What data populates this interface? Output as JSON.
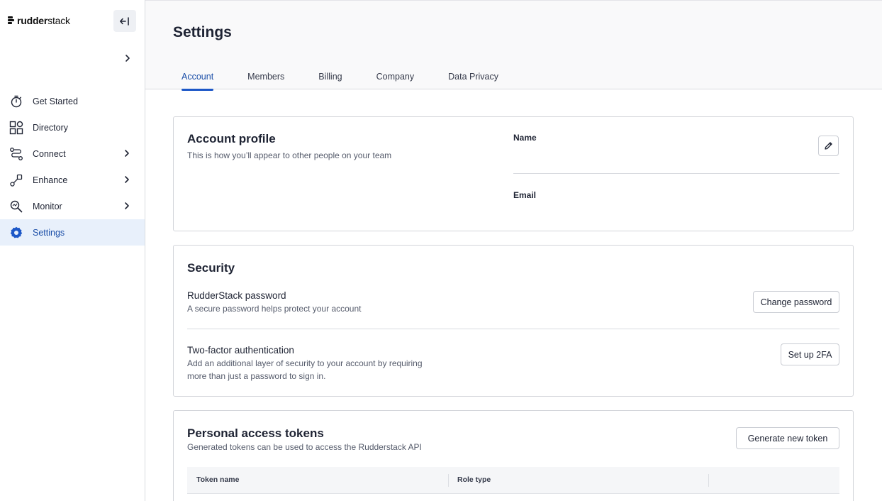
{
  "brand": {
    "logo_text_bold": "rudder",
    "logo_text_regular": "stack"
  },
  "sidebar": {
    "items": [
      {
        "label": "Get Started",
        "icon": "stopwatch-icon",
        "has_chevron": false,
        "active": false
      },
      {
        "label": "Directory",
        "icon": "grid-icon",
        "has_chevron": false,
        "active": false
      },
      {
        "label": "Connect",
        "icon": "connect-icon",
        "has_chevron": true,
        "active": false
      },
      {
        "label": "Enhance",
        "icon": "enhance-icon",
        "has_chevron": true,
        "active": false
      },
      {
        "label": "Monitor",
        "icon": "monitor-search-icon",
        "has_chevron": true,
        "active": false
      },
      {
        "label": "Settings",
        "icon": "gear-icon",
        "has_chevron": false,
        "active": true
      }
    ]
  },
  "header": {
    "title": "Settings",
    "tabs": [
      {
        "label": "Account",
        "active": true
      },
      {
        "label": "Members",
        "active": false
      },
      {
        "label": "Billing",
        "active": false
      },
      {
        "label": "Company",
        "active": false
      },
      {
        "label": "Data Privacy",
        "active": false
      }
    ]
  },
  "account_profile": {
    "title": "Account profile",
    "subtitle": "This is how you’ll appear to other people on your team",
    "name_label": "Name",
    "email_label": "Email"
  },
  "security": {
    "title": "Security",
    "password_title": "RudderStack password",
    "password_sub": "A secure password helps protect your account",
    "change_password_label": "Change password",
    "twofa_title": "Two-factor authentication",
    "twofa_sub": "Add an additional layer of security to your account by requiring more than just a password to sign in.",
    "setup_2fa_label": "Set up 2FA"
  },
  "tokens": {
    "title": "Personal access tokens",
    "subtitle": "Generated tokens can be used to access the Rudderstack API",
    "generate_label": "Generate new token",
    "columns": [
      "Token name",
      "Role type"
    ]
  },
  "colors": {
    "accent": "#1c57c7",
    "active_bg": "#e8f0fb",
    "border": "#d3d5da"
  }
}
